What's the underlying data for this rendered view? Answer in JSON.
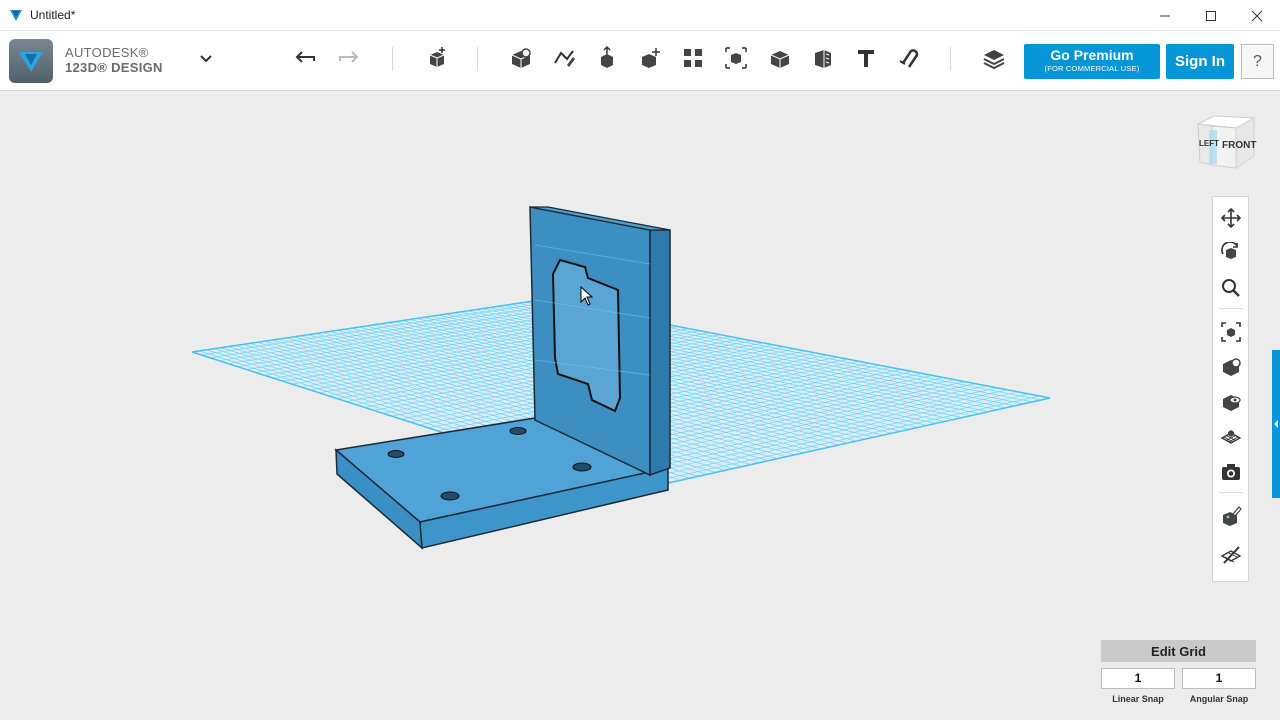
{
  "window": {
    "title": "Untitled*",
    "controls": [
      "minimize-icon",
      "maximize-icon",
      "close-icon"
    ]
  },
  "brand": {
    "line1": "AUTODESK®",
    "line2": "123D® DESIGN"
  },
  "toolbar": {
    "tools": [
      "undo-icon",
      "redo-icon",
      "transform-icon",
      "primitives-icon",
      "sketch-icon",
      "construct-icon",
      "modify-icon",
      "pattern-icon",
      "group-icon",
      "combine-icon",
      "measure-icon",
      "text-icon",
      "snap-icon",
      "materials-icon"
    ],
    "premium_label": "Go Premium",
    "premium_sub": "(FOR COMMERCIAL USE)",
    "signin_label": "Sign In",
    "help_label": "?"
  },
  "viewcube": {
    "face_left": "LEFT",
    "face_front": "FRONT"
  },
  "navbar": {
    "items": [
      "pan-icon",
      "orbit-icon",
      "zoom-icon",
      "fit-icon",
      "view-solid-icon",
      "view-hidden-icon",
      "grid-view-icon",
      "camera-icon",
      "material-edit-icon",
      "visibility-icon"
    ]
  },
  "grid_panel": {
    "title": "Edit Grid",
    "linear_snap_value": "1",
    "angular_snap_value": "1",
    "linear_snap_label": "Linear Snap",
    "angular_snap_label": "Angular Snap"
  },
  "colors": {
    "accent": "#0696d7",
    "grid": "#3fc1f0",
    "model": "#3a8fc4"
  }
}
